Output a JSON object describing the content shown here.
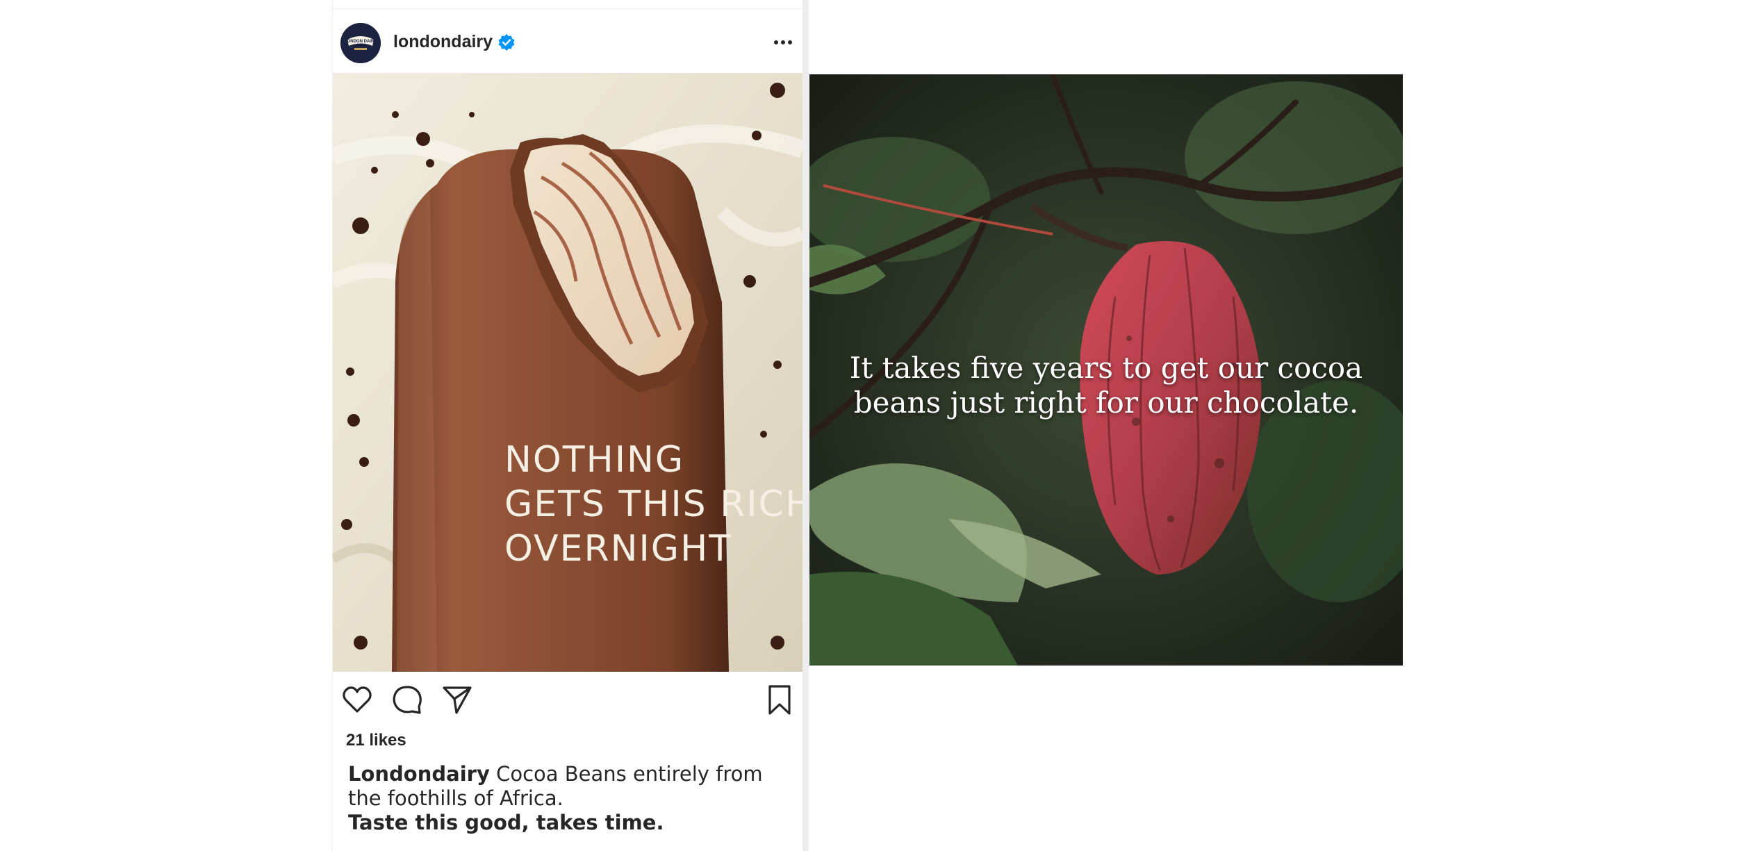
{
  "post": {
    "username": "londondairy",
    "avatar_text": "LONDON DAIRY",
    "image_overlay": [
      "NOTHING",
      "GETS THIS RICH",
      "OVERNIGHT"
    ],
    "likes": "21 likes",
    "caption_user": "Londondairy",
    "caption_text": " Cocoa Beans entirely from the foothills of Africa.",
    "caption_tagline": "Taste this good, takes time."
  },
  "second_image": {
    "overlay_line1": "It takes five years to get our cocoa",
    "overlay_line2": "beans just right for our chocolate."
  },
  "colors": {
    "verified": "#0095f6",
    "text": "#262626",
    "chocolate": "#8a4e33",
    "cream": "#ece6d6",
    "cocoa_pod": "#b8404c"
  },
  "icons": [
    "verified-badge-icon",
    "more-options-icon",
    "heart-icon",
    "comment-icon",
    "share-icon",
    "bookmark-icon"
  ]
}
